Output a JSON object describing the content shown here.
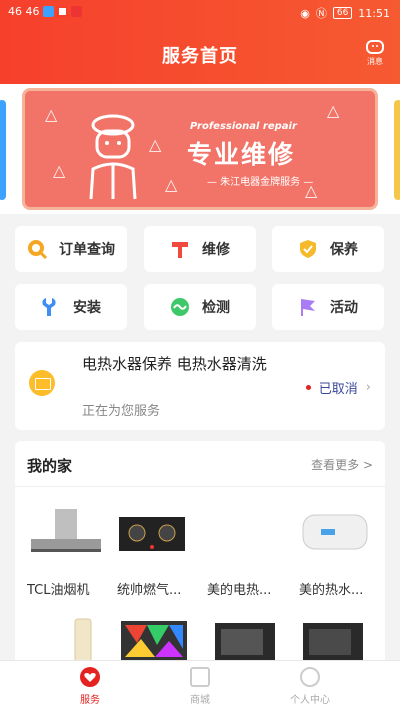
{
  "status_bar": {
    "left_text": "46  46",
    "time": "11:51",
    "battery": "66"
  },
  "header": {
    "title": "服务首页",
    "message_label": "消息"
  },
  "banner": {
    "title": "专业维修",
    "subtitle_en": "Professional repair",
    "subtitle": "— 朱江电器金牌服务 —"
  },
  "services": [
    {
      "label": "订单查询",
      "icon": "order-query-icon",
      "color": "#f5a623"
    },
    {
      "label": "维修",
      "icon": "repair-hammer-icon",
      "color": "#f0493e"
    },
    {
      "label": "保养",
      "icon": "maintenance-shield-icon",
      "color": "#f7b92c"
    },
    {
      "label": "安装",
      "icon": "install-wrench-icon",
      "color": "#3f8ef5"
    },
    {
      "label": "检测",
      "icon": "inspect-wave-icon",
      "color": "#3ec86a"
    },
    {
      "label": "活动",
      "icon": "activity-flag-icon",
      "color": "#a97bf5"
    }
  ],
  "order": {
    "title": "电热水器保养 电热水器清洗",
    "status": "已取消",
    "status_dot_color": "#e4221f",
    "subtitle": "正在为您服务"
  },
  "my_home": {
    "title": "我的家",
    "more": "查看更多 >",
    "products": [
      {
        "name": "TCL油烟机",
        "icon": "range-hood-icon"
      },
      {
        "name": "统帅燃气...",
        "icon": "gas-stove-icon"
      },
      {
        "name": "美的电热...",
        "icon": "water-heater-icon"
      },
      {
        "name": "美的热水...",
        "icon": "water-heater-icon"
      }
    ],
    "products_row2": [
      {
        "icon": "air-conditioner-icon"
      },
      {
        "icon": "tv-icon"
      },
      {
        "icon": "oven-icon"
      },
      {
        "icon": "oven-icon"
      }
    ]
  },
  "bottom_nav": [
    {
      "label": "服务",
      "active": true,
      "icon": "heart-icon"
    },
    {
      "label": "商城",
      "active": false,
      "icon": "shop-icon"
    },
    {
      "label": "个人中心",
      "active": false,
      "icon": "user-icon"
    }
  ],
  "colors": {
    "brand": "#f6402c",
    "active_nav": "#e4221f"
  }
}
